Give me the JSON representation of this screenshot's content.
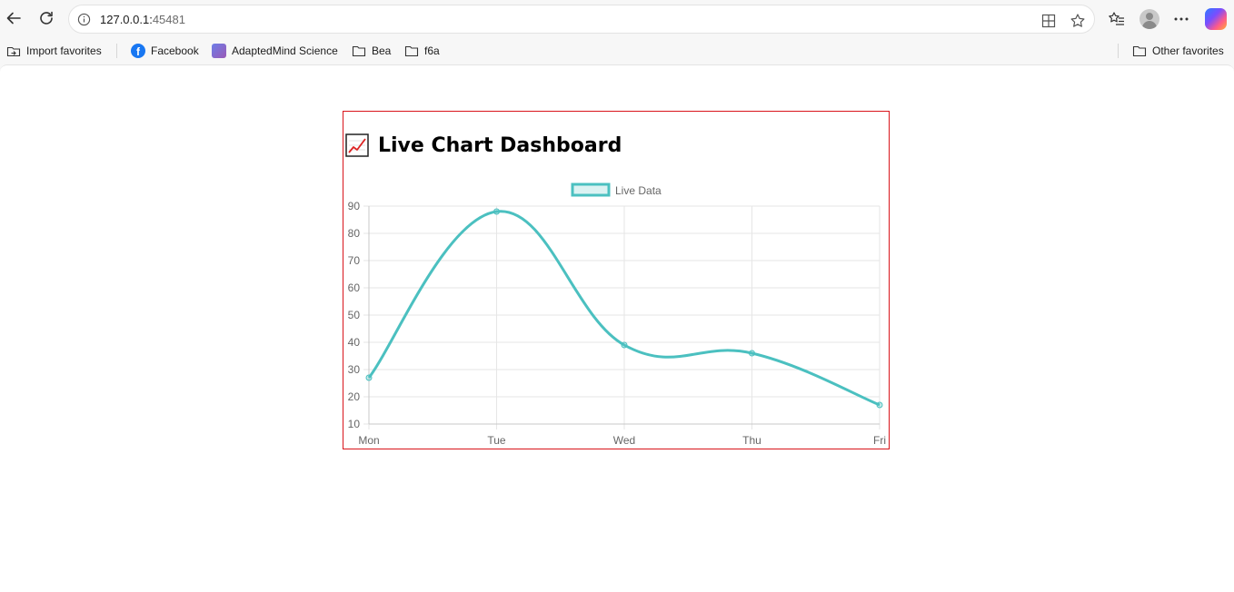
{
  "browser": {
    "url_host": "127.0.0.1:",
    "url_port": "45481",
    "bookmarks": [
      {
        "label": "Import favorites",
        "icon": "import-icon"
      },
      {
        "label": "Facebook",
        "icon": "facebook-icon"
      },
      {
        "label": "AdaptedMind Science",
        "icon": "adaptedmind-icon"
      },
      {
        "label": "Bea",
        "icon": "folder-icon"
      },
      {
        "label": "f6a",
        "icon": "folder-icon"
      }
    ],
    "other_favorites": "Other favorites"
  },
  "page": {
    "title": "Live Chart Dashboard",
    "title_icon": "chart-increasing-icon"
  },
  "chart_data": {
    "type": "line",
    "categories": [
      "Mon",
      "Tue",
      "Wed",
      "Thu",
      "Fri"
    ],
    "series": [
      {
        "name": "Live Data",
        "values": [
          27,
          88,
          39,
          36,
          17
        ],
        "color": "#4bc0c0"
      }
    ],
    "ylim": [
      10,
      90
    ],
    "yticks": [
      10,
      20,
      30,
      40,
      50,
      60,
      70,
      80,
      90
    ],
    "grid": true,
    "legend": "top-center",
    "curve": "smooth"
  }
}
